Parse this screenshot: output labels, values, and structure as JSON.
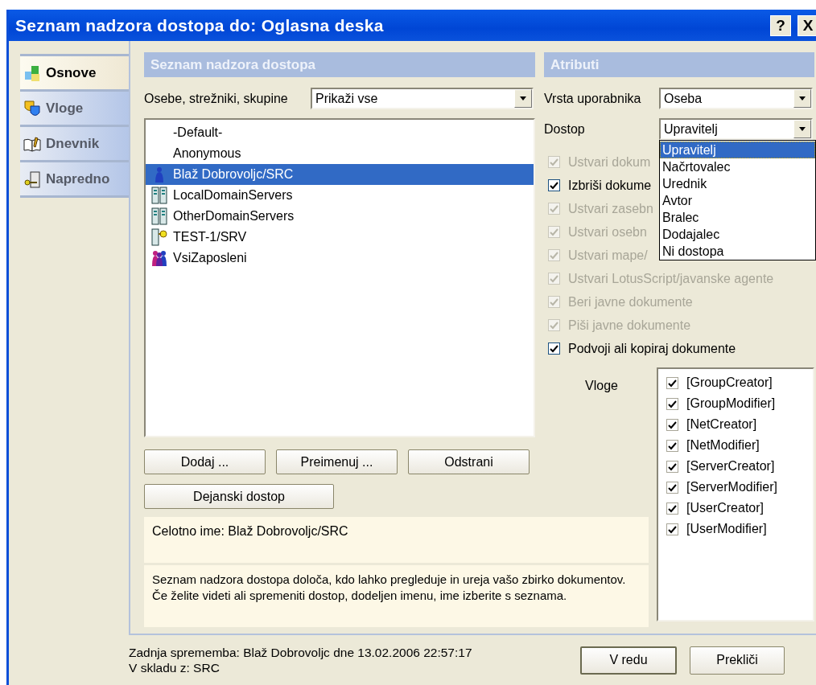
{
  "window": {
    "title": "Seznam nadzora dostopa do: Oglasna deska",
    "buttons": [
      "?",
      "X"
    ]
  },
  "sidebar": {
    "items": [
      {
        "label": "Osnove",
        "selected": true
      },
      {
        "label": "Vloge",
        "selected": false
      },
      {
        "label": "Dnevnik",
        "selected": false
      },
      {
        "label": "Napredno",
        "selected": false
      }
    ]
  },
  "acl_panel": {
    "title": "Seznam nadzora dostopa",
    "filter_label": "Osebe, strežniki, skupine",
    "filter_value": "Prikaži vse",
    "entries": [
      {
        "name": "-Default-",
        "kind": "plain",
        "selected": false
      },
      {
        "name": "Anonymous",
        "kind": "plain",
        "selected": false
      },
      {
        "name": "Blaž Dobrovoljc/SRC",
        "kind": "person",
        "selected": true
      },
      {
        "name": "LocalDomainServers",
        "kind": "servers",
        "selected": false
      },
      {
        "name": "OtherDomainServers",
        "kind": "servers",
        "selected": false
      },
      {
        "name": "TEST-1/SRV",
        "kind": "server",
        "selected": false
      },
      {
        "name": "VsiZaposleni",
        "kind": "group",
        "selected": false
      }
    ],
    "buttons": [
      "Dodaj ...",
      "Preimenuj ...",
      "Odstrani"
    ],
    "effective_button": "Dejanski dostop",
    "full_name": "Celotno ime: Blaž Dobrovoljc/SRC",
    "description": "Seznam nadzora dostopa določa, kdo lahko pregleduje in ureja vašo zbirko dokumentov. Če želite videti ali spremeniti dostop, dodeljen imenu, ime izberite s seznama."
  },
  "attributes": {
    "title": "Atributi",
    "user_type_label": "Vrsta uporabnika",
    "user_type": "Oseba",
    "access_label": "Dostop",
    "access": "Upravitelj",
    "access_options": [
      {
        "label": "Upravitelj",
        "selected": true
      },
      {
        "label": "Načrtovalec",
        "selected": false
      },
      {
        "label": "Urednik",
        "selected": false
      },
      {
        "label": "Avtor",
        "selected": false
      },
      {
        "label": "Bralec",
        "selected": false
      },
      {
        "label": "Dodajalec",
        "selected": false
      },
      {
        "label": "Ni dostopa",
        "selected": false
      }
    ],
    "permissions": [
      {
        "label": "Ustvari dokum",
        "checked": true,
        "disabled": true
      },
      {
        "label": "Izbriši dokume",
        "checked": true,
        "disabled": false
      },
      {
        "label": "Ustvari zasebn",
        "checked": true,
        "disabled": true
      },
      {
        "label": "Ustvari osebn",
        "checked": true,
        "disabled": true
      },
      {
        "label": "Ustvari mape/",
        "checked": true,
        "disabled": true
      },
      {
        "label": "Ustvari LotusScript/javanske agente",
        "checked": true,
        "disabled": true
      },
      {
        "label": "Beri javne dokumente",
        "checked": true,
        "disabled": true
      },
      {
        "label": "Piši javne dokumente",
        "checked": true,
        "disabled": true
      },
      {
        "label": "Podvoji ali kopiraj dokumente",
        "checked": true,
        "disabled": false
      }
    ],
    "roles_label": "Vloge",
    "roles": [
      {
        "label": "[GroupCreator]",
        "checked": true
      },
      {
        "label": "[GroupModifier]",
        "checked": true
      },
      {
        "label": "[NetCreator]",
        "checked": true
      },
      {
        "label": "[NetModifier]",
        "checked": true
      },
      {
        "label": "[ServerCreator]",
        "checked": true
      },
      {
        "label": "[ServerModifier]",
        "checked": true
      },
      {
        "label": "[UserCreator]",
        "checked": true
      },
      {
        "label": "[UserModifier]",
        "checked": true
      }
    ]
  },
  "status": {
    "last_change": "Zadnja sprememba: Blaž Dobrovoljc dne 13.02.2006 22:57:17",
    "replica": "V skladu z: SRC"
  },
  "buttons": [
    "V redu",
    "Prekliči"
  ]
}
